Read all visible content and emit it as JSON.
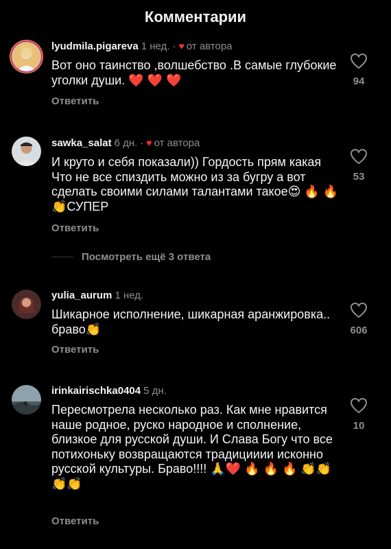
{
  "header": {
    "title": "Комментарии"
  },
  "comments": [
    {
      "username": "lyudmila.pigareva",
      "time": "1 нед.",
      "author_heart": "от автора",
      "text": "Вот оно таинство ,волшебство .В самые глубокие уголки души. ❤️ ❤️ ❤️",
      "reply_label": "Ответить",
      "likes": "94"
    },
    {
      "username": "sawka_salat",
      "time": "6 дн.",
      "author_heart": "от автора",
      "text": "И круто и себя показали)) Гордость прям какая Что не все спиздить можно из за бугру а вот сделать своими силами талантами такое😍 🔥 🔥 👏СУПЕР",
      "reply_label": "Ответить",
      "likes": "53"
    },
    {
      "username": "yulia_aurum",
      "time": "1 нед.",
      "text": "Шикарное исполнение, шикарная аранжировка.. браво👏",
      "reply_label": "Ответить",
      "likes": "606"
    },
    {
      "username": "irinkairischka0404",
      "time": "5 дн.",
      "text": "Пересмотрела несколько раз. Как мне нравится наше родное, руско народное и сполнение, близкое для русской души. И Слава Богу что все потихоньку возвращаются традицииии исконно русской культуры. Браво!!!! 🙏❤️ 🔥 🔥 🔥 👏👏👏👏",
      "reply_label": "Ответить",
      "likes": "10"
    }
  ],
  "more_replies": "Посмотреть ещё 3 ответа",
  "colors": {
    "background": "#000000",
    "secondary_text": "#8e8e8e",
    "heart_red": "#ff3040"
  }
}
